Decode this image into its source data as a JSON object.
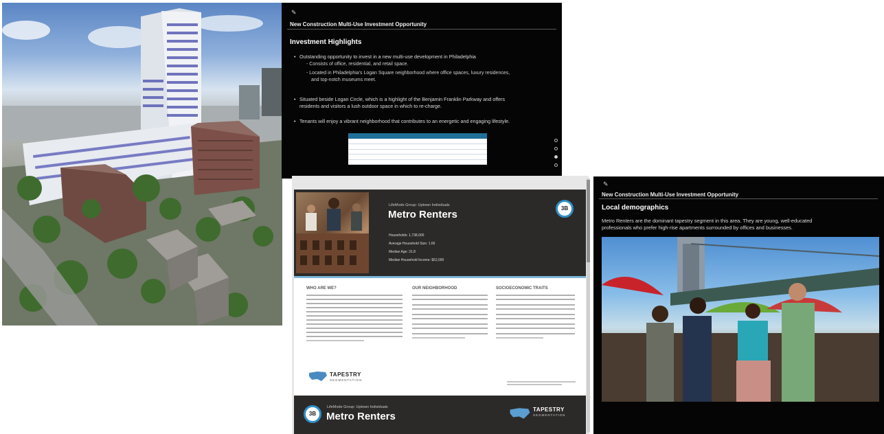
{
  "top_panel": {
    "title": "New Construction Multi-Use Investment Opportunity",
    "heading": "Investment Highlights",
    "bullets": {
      "b1": "Outstanding opportunity to invest in a new multi-use development in Philadelphia",
      "b1_sub1": "Consists of office, residential, and retail space.",
      "b1_sub2": "Located in Philadelphia's Logan Square neighborhood where office spaces, luxury residences,",
      "b1_sub2b": "and top-notch museums meet.",
      "b2": "Situated beside Logan Circle, which is a highlight of the Benjamin Franklin Parkway and offers",
      "b2b": "residents and visitors a lush outdoor space in which to re-charge.",
      "b3": "Tenants will enjoy a vibrant neighborhood that contributes to an energetic and engaging lifestyle."
    }
  },
  "doc": {
    "lifemode": "LifeMode Group: Uptown Individuals",
    "segment": "Metro Renters",
    "badge": "3B",
    "stats": {
      "households": "Households: 1,738,000",
      "hh_size": "Average Household Size: 1.66",
      "median_age": "Median Age: 31.8",
      "median_income": "Median Household Income: $52,000"
    },
    "columns": {
      "c1": "WHO ARE WE?",
      "c2": "OUR NEIGHBORHOOD",
      "c3": "SOCIOECONOMIC TRAITS"
    },
    "brand": "TAPESTRY",
    "brand_sub": "SEGMENTATION",
    "footer_lifemode": "LifeMode Group: Uptown Individuals",
    "footer_segment": "Metro Renters",
    "footer_badge": "3B"
  },
  "right_panel": {
    "title": "New Construction Multi-Use Investment Opportunity",
    "heading": "Local demographics",
    "para1": "Metro Renters are the dominant tapestry segment in this area. They are young, well-educated",
    "para2": "professionals who prefer high-rise apartments surrounded by offices and businesses."
  },
  "colors": {
    "panel_bg": "#050505",
    "doc_header": "#2c2a29",
    "accent_blue": "#2f8fc4"
  },
  "icons": {
    "pin": "pin-icon",
    "usa_map": "usa-map-icon"
  }
}
